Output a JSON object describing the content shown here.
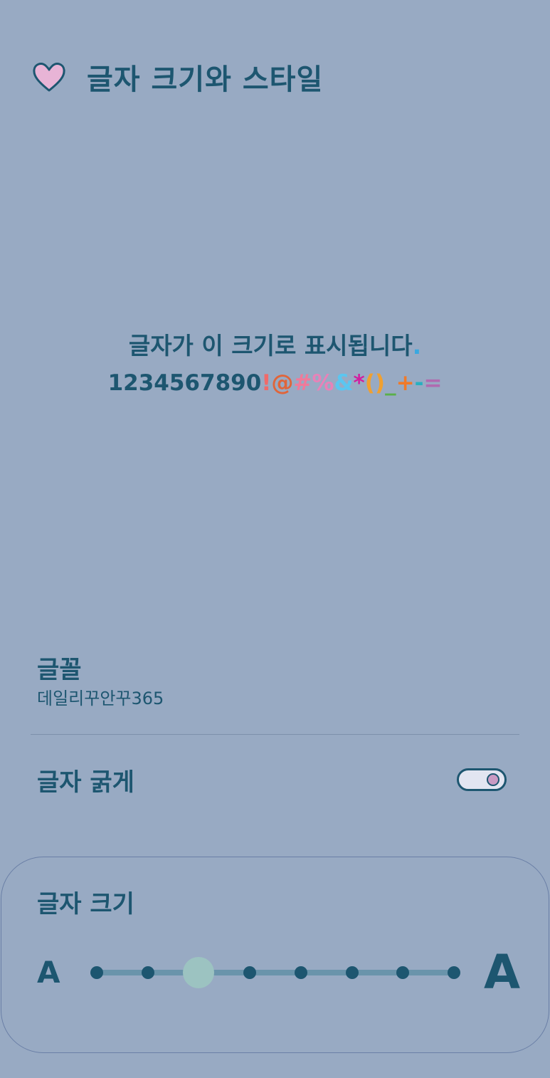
{
  "header": {
    "title": "글자 크기와 스타일",
    "icon": "heart-icon",
    "icon_color": "#e8b4d6"
  },
  "preview": {
    "line1": "글자가 이 크기로 표시됩니다",
    "line1_dot": ".",
    "digits": "1234567890",
    "symbols": [
      "!",
      "@",
      "#",
      "%",
      "&",
      "*",
      "()",
      "_",
      "+",
      "-",
      "="
    ]
  },
  "font": {
    "label": "글꼴",
    "value": "데일리꾸안꾸365"
  },
  "bold": {
    "label": "글자 굵게",
    "enabled": true
  },
  "size": {
    "label": "글자 크기",
    "small_glyph": "A",
    "large_glyph": "A",
    "steps": 8,
    "selected_index": 2
  },
  "colors": {
    "background": "#98aac3",
    "text": "#1d5670",
    "accent_thumb": "#9cc3c1",
    "toggle_knob": "#c99ac3"
  }
}
